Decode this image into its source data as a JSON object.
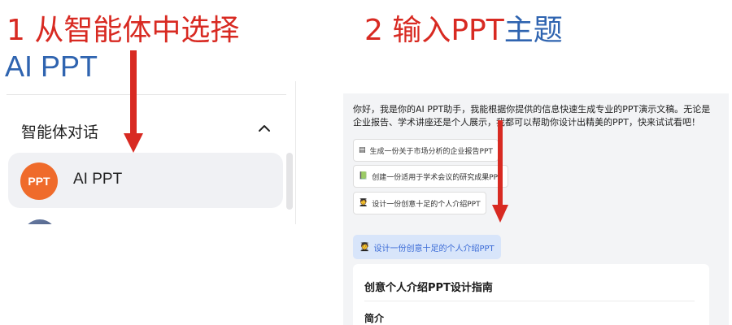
{
  "step1": {
    "heading": "1 从智能体中选择",
    "subheading": "AI PPT"
  },
  "step2": {
    "number": "2 输入PPT",
    "heading_end": "主题"
  },
  "sidebar": {
    "section_title": "智能体对话",
    "collapse_icon": "chevron-up-icon",
    "items": [
      {
        "avatar_text": "PPT",
        "label": "AI PPT"
      }
    ]
  },
  "chat": {
    "intro": "你好，我是你的AI PPT助手，我能根据你提供的信息快速生成专业的PPT演示文稿。无论是企业报告、学术讲座还是个人展示，我都可以帮助你设计出精美的PPT，快来试试看吧！",
    "suggestions": [
      {
        "icon": "document-icon",
        "glyph": "▤",
        "label": "生成一份关于市场分析的企业报告PPT"
      },
      {
        "icon": "book-icon",
        "glyph": "📗",
        "label": "创建一份适用于学术会议的研究成果PPT"
      },
      {
        "icon": "student-icon",
        "glyph": "🧑‍🎓",
        "label": "设计一份创意十足的个人介绍PPT"
      }
    ],
    "user_message": {
      "glyph": "🧑‍🎓",
      "text": "设计一份创意十足的个人介绍PPT"
    },
    "response": {
      "title": "创意个人介绍PPT设计指南",
      "section": "简介"
    }
  },
  "colors": {
    "annotation_red": "#d82a22",
    "accent_blue": "#2f64b0",
    "avatar_orange": "#ef6b2b"
  }
}
